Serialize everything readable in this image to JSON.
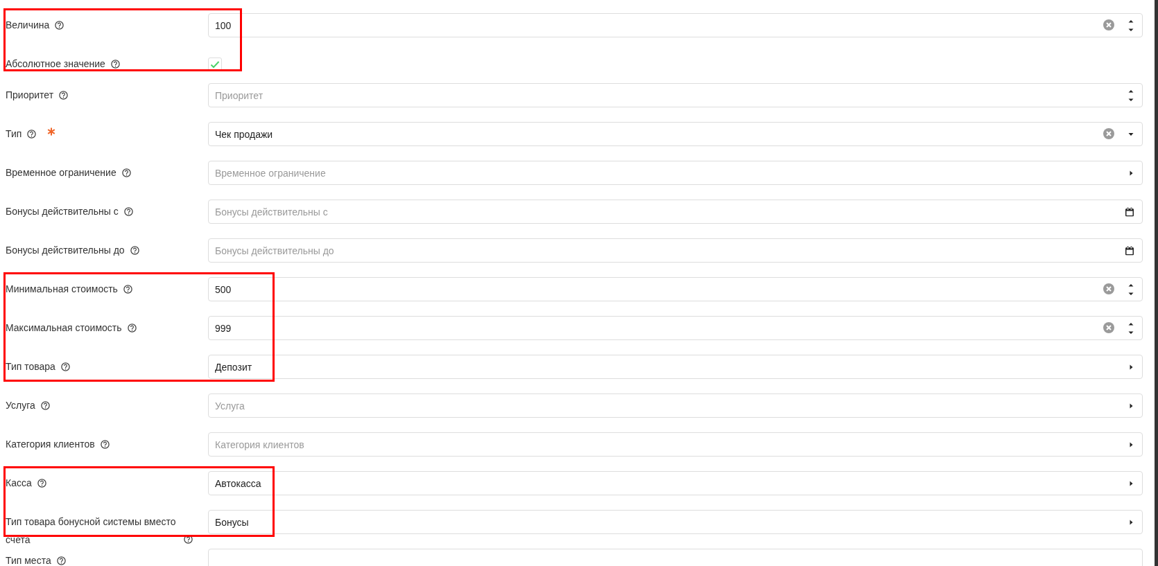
{
  "groups": [
    {
      "highlighted": true,
      "fields": [
        {
          "kind": "number",
          "label": "Величина",
          "required": false,
          "value": "100"
        },
        {
          "kind": "checkbox",
          "label": "Абсолютное значение",
          "required": false,
          "checked": true
        }
      ]
    },
    {
      "highlighted": false,
      "fields": [
        {
          "kind": "number",
          "label": "Приоритет",
          "required": false,
          "placeholder": "Приоритет"
        },
        {
          "kind": "select",
          "label": "Тип",
          "required": true,
          "value": "Чек продажи"
        },
        {
          "kind": "link",
          "label": "Временное ограничение",
          "required": false,
          "placeholder": "Временное ограничение"
        },
        {
          "kind": "date",
          "label": "Бонусы действительны с",
          "required": false,
          "placeholder": "Бонусы действительны с"
        },
        {
          "kind": "date",
          "label": "Бонусы действительны до",
          "required": false,
          "placeholder": "Бонусы действительны до"
        }
      ]
    },
    {
      "highlighted": true,
      "fields": [
        {
          "kind": "number",
          "label": "Минимальная стоимость",
          "required": false,
          "value": "500"
        },
        {
          "kind": "number",
          "label": "Максимальная стоимость",
          "required": false,
          "value": "999"
        },
        {
          "kind": "link",
          "label": "Тип товара",
          "required": false,
          "value": "Депозит"
        }
      ]
    },
    {
      "highlighted": false,
      "fields": [
        {
          "kind": "link",
          "label": "Услуга",
          "required": false,
          "placeholder": "Услуга"
        },
        {
          "kind": "link",
          "label": "Категория клиентов",
          "required": false,
          "placeholder": "Категория клиентов"
        }
      ]
    },
    {
      "highlighted": true,
      "fields": [
        {
          "kind": "link",
          "label": "Касса",
          "required": false,
          "value": "Автокасса"
        },
        {
          "kind": "link",
          "label": "Тип товара бонусной системы вместо счета",
          "required": false,
          "value": "Бонусы"
        }
      ]
    },
    {
      "highlighted": false,
      "fields": [
        {
          "kind": "text",
          "label": "Тип места",
          "required": false
        }
      ]
    }
  ]
}
